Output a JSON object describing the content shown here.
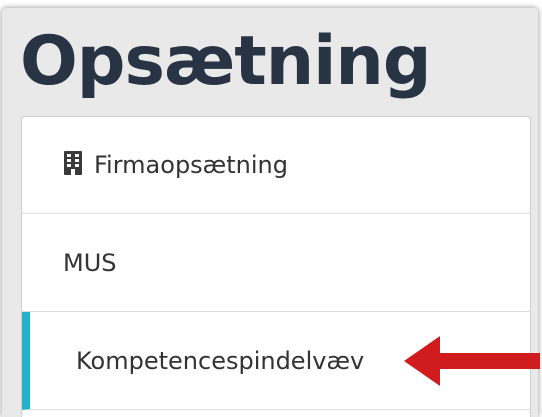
{
  "page": {
    "title": "Opsætning"
  },
  "menu": {
    "items": [
      {
        "label": "Firmaopsætning",
        "icon": "building-icon"
      },
      {
        "label": "MUS"
      },
      {
        "label": "Kompetencespindelvæv",
        "active": true
      }
    ]
  },
  "colors": {
    "title": "#283443",
    "active_indicator": "#22b3cf",
    "annotation_arrow": "#d01c1c"
  },
  "annotation": {
    "icon": "arrow-left-icon",
    "points_to": "Kompetencespindelvæv"
  }
}
